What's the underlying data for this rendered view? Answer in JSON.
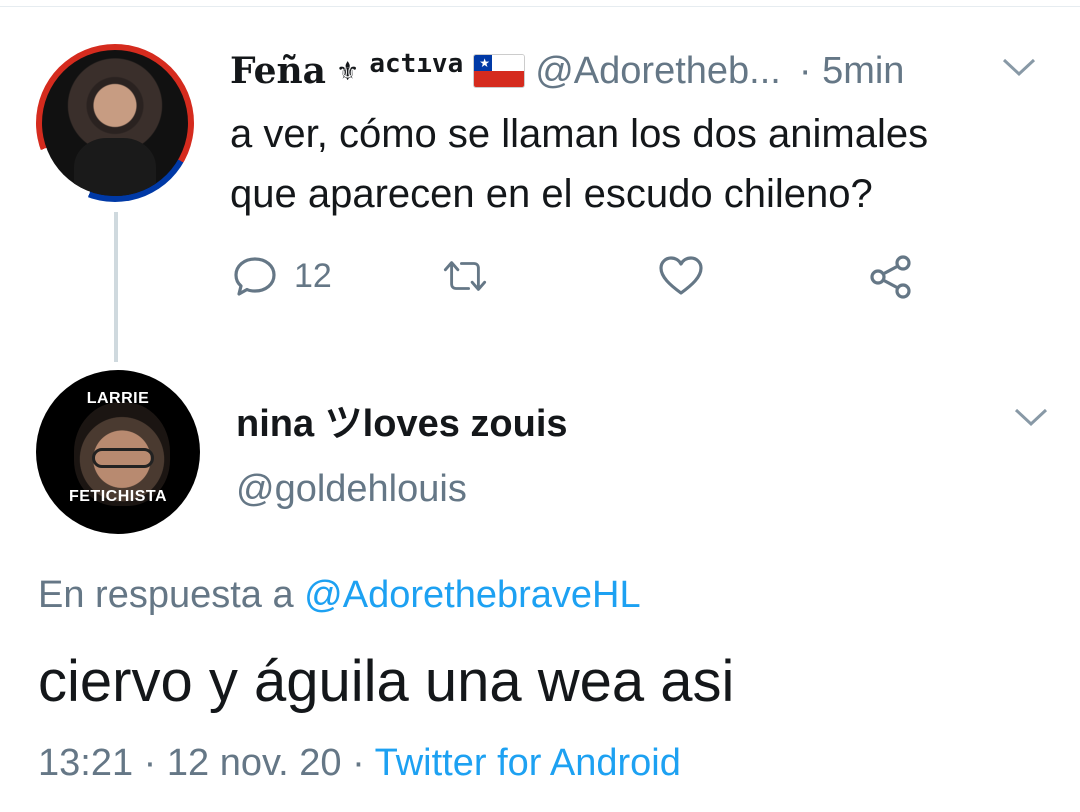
{
  "tweet1": {
    "display_name": "Feña",
    "ornament": "⚜",
    "badge_text": "actıva",
    "flag_icon": "chile-flag-icon",
    "handle": "@Adoretheb...",
    "separator": "·",
    "time": "5min",
    "text_line1": "a ver, cómo se llaman los dos animales",
    "text_line2": "que aparecen en el escudo chileno?",
    "reply_count": "12",
    "actions": [
      "reply-icon",
      "retweet-icon",
      "like-icon",
      "share-icon"
    ]
  },
  "tweet2": {
    "display_name": "nina ツloves zouis",
    "handle": "@goldehlouis",
    "avatar_top_label": "LARRIE",
    "avatar_bottom_label": "FETICHISTA",
    "reply_prefix": "En respuesta a",
    "reply_mention": "@AdorethebraveHL",
    "text": "ciervo y águila una wea asi",
    "time": "13:21",
    "sep1": "·",
    "date": "12 nov. 20",
    "sep2": "·",
    "source": "Twitter for Android"
  },
  "colors": {
    "text": "#14171a",
    "secondary": "#657786",
    "link": "#1da1f2",
    "thread_line": "#cfd9de"
  }
}
